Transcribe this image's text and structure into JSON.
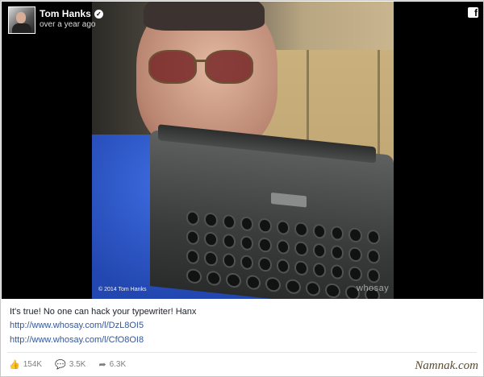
{
  "post": {
    "author": "Tom Hanks",
    "timestamp": "over a year ago",
    "text": "It's true! No one can hack your typewriter! Hanx",
    "links": [
      "http://www.whosay.com/l/DzL8OI5",
      "http://www.whosay.com/l/CfO8OI8"
    ]
  },
  "photo": {
    "copyright": "© 2014 Tom Hanks",
    "watermark": "whosay"
  },
  "stats": {
    "likes": "154K",
    "comments": "3.5K",
    "shares": "6.3K"
  },
  "watermark_site": "Namnak.com",
  "icons": {
    "verified": "verified-badge-icon",
    "facebook": "facebook-icon",
    "like": "thumbs-up-icon",
    "comment": "comment-icon",
    "share": "share-icon"
  },
  "colors": {
    "link": "#365899",
    "text": "#1d2129",
    "muted": "#7f7f7f"
  }
}
